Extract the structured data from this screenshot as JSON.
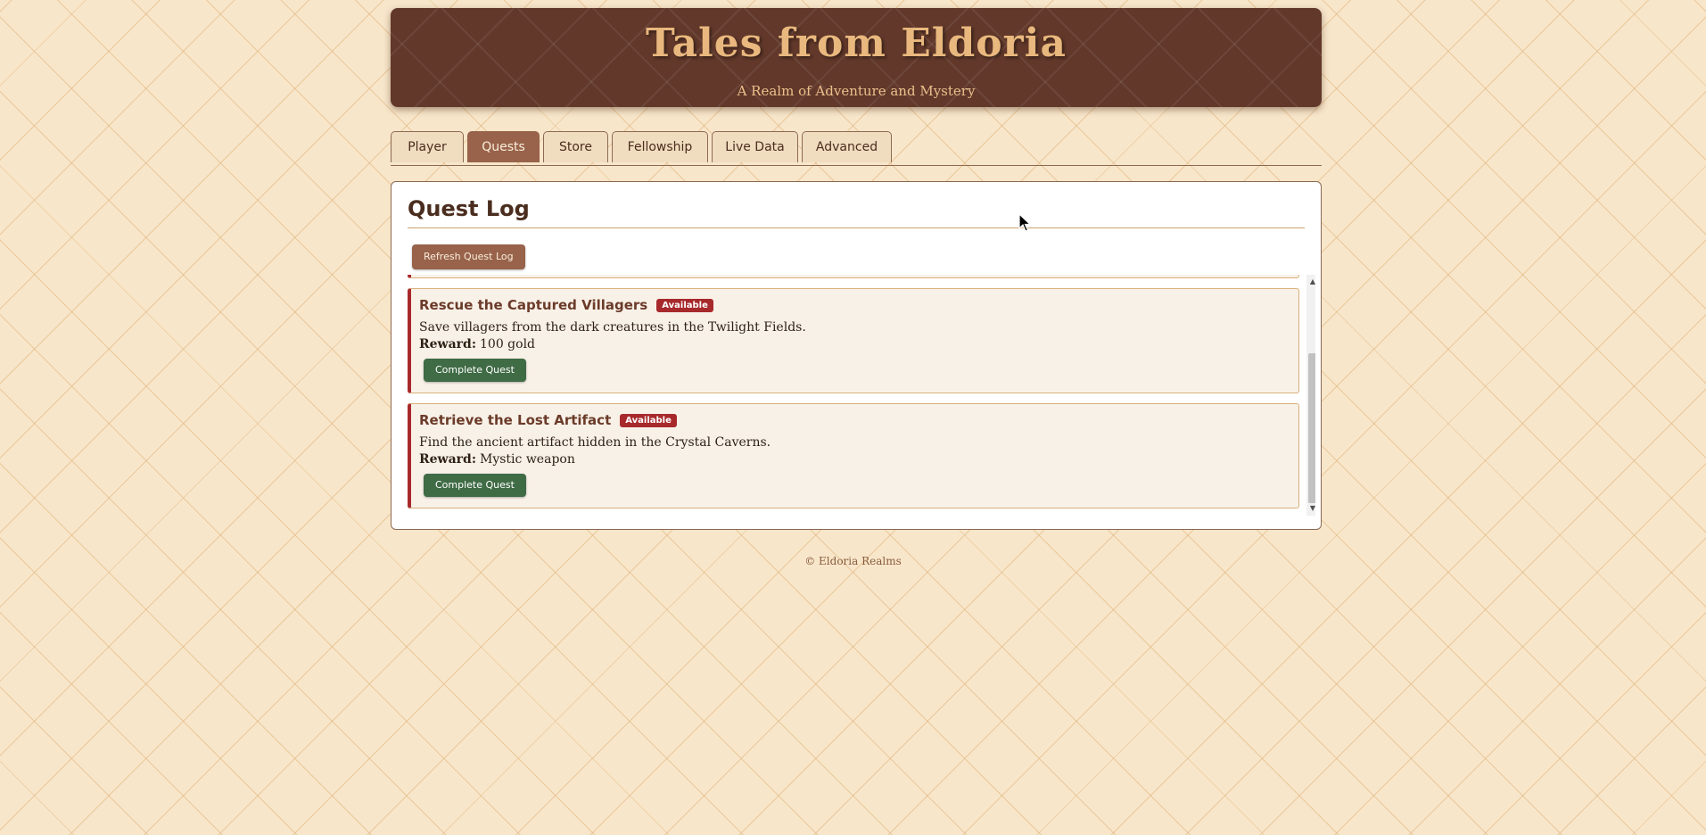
{
  "header": {
    "title": "Tales from Eldoria",
    "subtitle": "A Realm of Adventure and Mystery"
  },
  "tabs": [
    {
      "label": "Player",
      "active": false
    },
    {
      "label": "Quests",
      "active": true
    },
    {
      "label": "Store",
      "active": false
    },
    {
      "label": "Fellowship",
      "active": false
    },
    {
      "label": "Live Data",
      "active": false
    },
    {
      "label": "Advanced",
      "active": false
    }
  ],
  "quest_log": {
    "title": "Quest Log",
    "refresh_label": "Refresh Quest Log",
    "quests": [
      {
        "title": "Rescue the Captured Villagers",
        "status": "Available",
        "description": "Save villagers from the dark creatures in the Twilight Fields.",
        "reward_label": "Reward:",
        "reward": "100 gold",
        "action_label": "Complete Quest"
      },
      {
        "title": "Retrieve the Lost Artifact",
        "status": "Available",
        "description": "Find the ancient artifact hidden in the Crystal Caverns.",
        "reward_label": "Reward:",
        "reward": "Mystic weapon",
        "action_label": "Complete Quest"
      }
    ]
  },
  "footer": {
    "text": "© Eldoria Realms"
  },
  "colors": {
    "header_bg": "#61382a",
    "title_gold": "#e9b87e",
    "active_tab": "#98634a",
    "badge_red": "#a7292c",
    "complete_green": "#3f6b45",
    "page_bg": "#f8e6ca"
  }
}
